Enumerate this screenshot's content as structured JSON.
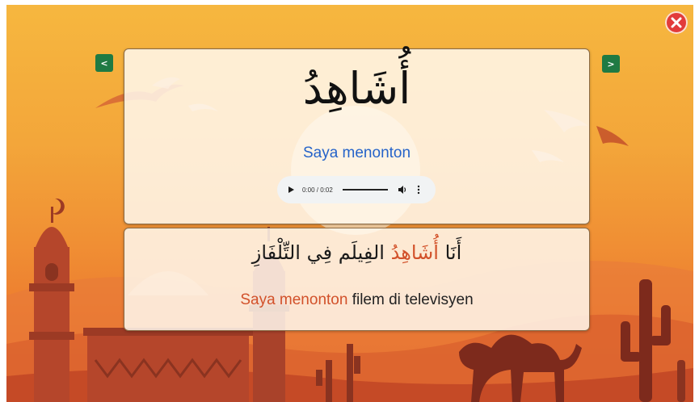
{
  "controls": {
    "prev_label": "<",
    "next_label": ">"
  },
  "word_card": {
    "arabic": "أُشَاهِدُ",
    "translation": "Saya menonton",
    "audio": {
      "time_display": "0:00 / 0:02",
      "progress": 0
    }
  },
  "sentence_card": {
    "arabic_before": "أَنَا ",
    "arabic_highlight": "أُشَاهِدُ",
    "arabic_after": " الفِيلَم فِي التِّلْفَازِ",
    "malay_highlight": "Saya menonton",
    "malay_rest": " filem di televisyen"
  },
  "colors": {
    "highlight": "#d2512a",
    "translation": "#2563c9",
    "nav_button": "#1f7a43",
    "close_button": "#e23b3b"
  },
  "icons": {
    "close": "close-icon",
    "play": "play-icon",
    "volume": "volume-icon",
    "more": "more-options-icon"
  }
}
